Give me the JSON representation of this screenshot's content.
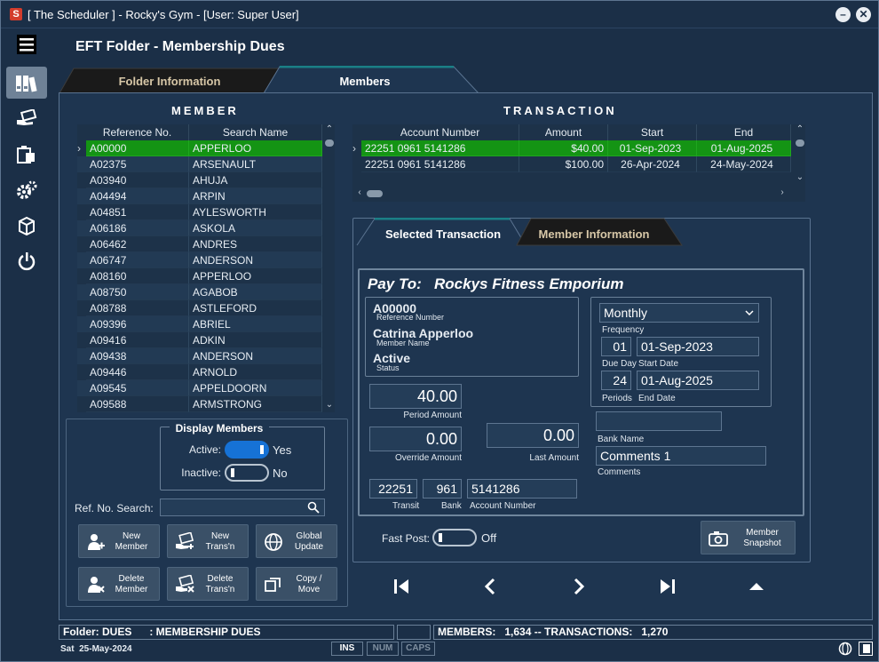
{
  "window": {
    "title": "[ The Scheduler ] - Rocky's Gym - [User: Super User]",
    "logo": "S"
  },
  "page": {
    "title": "EFT Folder - Membership Dues"
  },
  "tabs": [
    {
      "label": "Folder Information"
    },
    {
      "label": "Members"
    }
  ],
  "member": {
    "title": "MEMBER",
    "columns": [
      "Reference No.",
      "Search Name"
    ],
    "rows": [
      [
        "A00000",
        "APPERLOO"
      ],
      [
        "A02375",
        "ARSENAULT"
      ],
      [
        "A03940",
        "AHUJA"
      ],
      [
        "A04494",
        "ARPIN"
      ],
      [
        "A04851",
        "AYLESWORTH"
      ],
      [
        "A06186",
        "ASKOLA"
      ],
      [
        "A06462",
        "ANDRES"
      ],
      [
        "A06747",
        "ANDERSON"
      ],
      [
        "A08160",
        "APPERLOO"
      ],
      [
        "A08750",
        "AGABOB"
      ],
      [
        "A08788",
        "ASTLEFORD"
      ],
      [
        "A09396",
        "ABRIEL"
      ],
      [
        "A09416",
        "ADKIN"
      ],
      [
        "A09438",
        "ANDERSON"
      ],
      [
        "A09446",
        "ARNOLD"
      ],
      [
        "A09545",
        "APPELDOORN"
      ],
      [
        "A09588",
        "ARMSTRONG"
      ]
    ]
  },
  "transaction": {
    "title": "TRANSACTION",
    "columns": [
      "Account Number",
      "Amount",
      "Start",
      "End"
    ],
    "rows": [
      [
        "22251 0961 5141286",
        "$40.00",
        "01-Sep-2023",
        "01-Aug-2025"
      ],
      [
        "22251 0961 5141286",
        "$100.00",
        "26-Apr-2024",
        "24-May-2024"
      ]
    ]
  },
  "display": {
    "title": "Display Members",
    "active_label": "Active:",
    "active_value": "Yes",
    "inactive_label": "Inactive:",
    "inactive_value": "No"
  },
  "search": {
    "label": "Ref. No. Search:",
    "value": ""
  },
  "buttons": {
    "new_member": "New Member",
    "new_trans": "New Trans'n",
    "global_update": "Global Update",
    "delete_member": "Delete Member",
    "delete_trans": "Delete Trans'n",
    "copy_move": "Copy / Move",
    "member_snapshot": "Member Snapshot"
  },
  "subtabs": [
    {
      "label": "Selected Transaction"
    },
    {
      "label": "Member Information"
    }
  ],
  "detail": {
    "pay_to_label": "Pay To:",
    "pay_to": "Rockys Fitness Emporium",
    "ref_no": "A00000",
    "ref_no_label": "Reference Number",
    "member_name": "Catrina Apperloo",
    "member_name_label": "Member Name",
    "status": "Active",
    "status_label": "Status",
    "period_amount": "40.00",
    "period_amount_label": "Period Amount",
    "override_amount": "0.00",
    "override_amount_label": "Override Amount",
    "last_amount": "0.00",
    "last_amount_label": "Last Amount",
    "transit": "22251",
    "transit_label": "Transit",
    "bank": "961",
    "bank_label": "Bank",
    "account": "5141286",
    "account_label": "Account Number",
    "frequency": "Monthly",
    "frequency_label": "Frequency",
    "due_day": "01",
    "due_day_label": "Due Day",
    "start_date": "01-Sep-2023",
    "start_date_label": "Start Date",
    "periods": "24",
    "periods_label": "Periods",
    "end_date": "01-Aug-2025",
    "end_date_label": "End Date",
    "bank_name": "",
    "bank_name_label": "Bank Name",
    "comments": "Comments 1",
    "comments_label": "Comments",
    "fast_post_label": "Fast Post:",
    "fast_post_value": "Off"
  },
  "status": {
    "folder": "Folder: DUES      : MEMBERSHIP DUES",
    "counts": "MEMBERS:   1,634 -- TRANSACTIONS:   1,270",
    "date": "Sat  25-May-2024",
    "keys": [
      "INS",
      "NUM",
      "CAPS"
    ]
  },
  "colors": {
    "selection": "#149414",
    "accent_teal": "#1a7f86",
    "toggle_on": "#1672d6"
  }
}
